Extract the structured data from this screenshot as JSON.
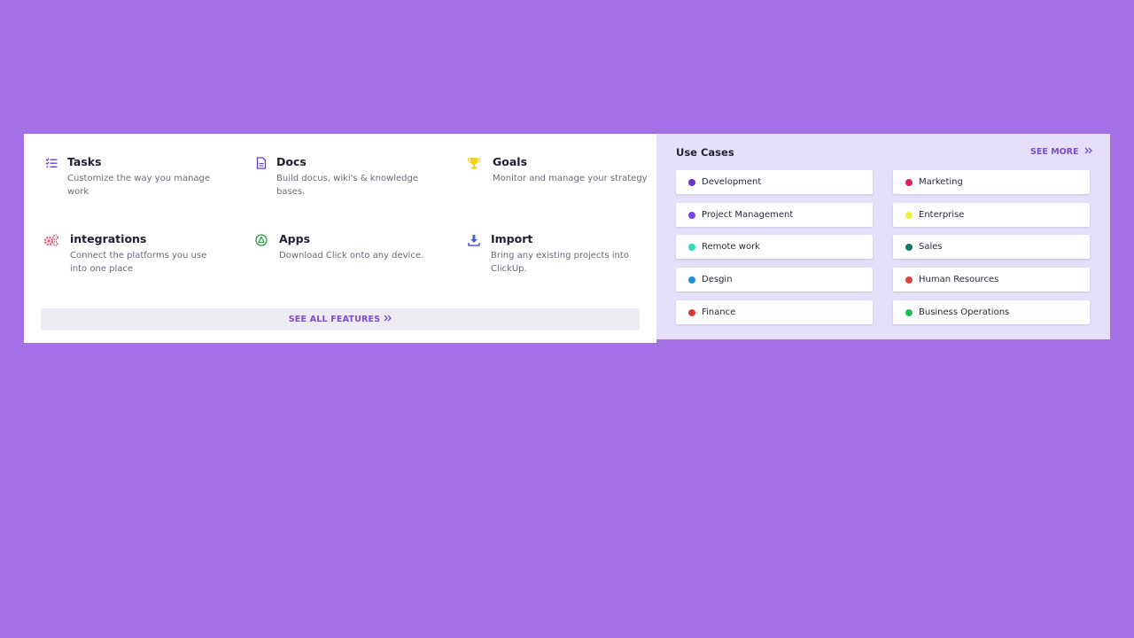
{
  "features": {
    "items": [
      {
        "title": "Tasks",
        "desc": "Customize the way you manage work",
        "icon": "checklist-icon",
        "color": "#6d3fd6"
      },
      {
        "title": "Docs",
        "desc": "Build docus, wiki's & knowledge bases.",
        "icon": "document-icon",
        "color": "#5b3ec9"
      },
      {
        "title": "Goals",
        "desc": "Monitor and manage your strategy",
        "icon": "trophy-icon",
        "color": "#f2d21b"
      },
      {
        "title": "integrations",
        "desc": "Connect the platforms you use into one place",
        "icon": "gears-icon",
        "color": "#e35d7c"
      },
      {
        "title": "Apps",
        "desc": "Download Click onto any device.",
        "icon": "apps-icon",
        "color": "#2e9a4a"
      },
      {
        "title": "Import",
        "desc": "Bring any existing projects into ClickUp.",
        "icon": "download-icon",
        "color": "#4e5fd8"
      }
    ],
    "see_all_label": "SEE ALL FEATURES"
  },
  "usecases": {
    "title": "Use Cases",
    "see_more_label": "SEE MORE",
    "items": [
      {
        "label": "Development",
        "color": "#6a35c9"
      },
      {
        "label": "Marketing",
        "color": "#e0245e"
      },
      {
        "label": "Project Management",
        "color": "#7a3ff0"
      },
      {
        "label": "Enterprise",
        "color": "#f0f03c"
      },
      {
        "label": "Remote work",
        "color": "#2ed9b8"
      },
      {
        "label": "Sales",
        "color": "#0f7a6e"
      },
      {
        "label": "Desgin",
        "color": "#1e8fe0"
      },
      {
        "label": "Human Resources",
        "color": "#e0443c"
      },
      {
        "label": "Finance",
        "color": "#e03a30"
      },
      {
        "label": "Business Operations",
        "color": "#1fbf55"
      }
    ]
  }
}
